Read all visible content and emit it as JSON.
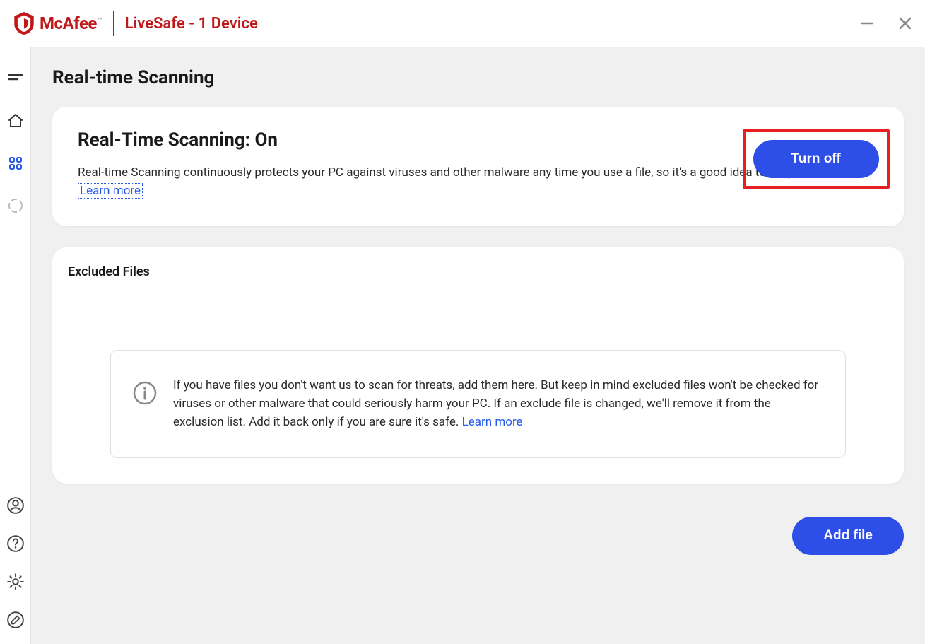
{
  "header": {
    "brand": "McAfee",
    "product": "LiveSafe - 1 Device"
  },
  "page": {
    "title": "Real-time Scanning"
  },
  "status": {
    "title": "Real-Time Scanning: On",
    "description": "Real-time Scanning continuously protects your PC against viruses and other malware any time you use a file, so it's a good idea to keep it turned on. ",
    "learn_more": "Learn more",
    "turn_off_label": "Turn off"
  },
  "excluded": {
    "title": "Excluded Files",
    "info": "If you have files you don't want us to scan for threats, add them here. But keep in mind excluded files won't be checked for viruses or other malware that could seriously harm your PC. If an exclude file is changed, we'll remove it from the exclusion list. Add it back only if you are sure it's safe. ",
    "learn_more": "Learn more",
    "add_file_label": "Add file"
  }
}
